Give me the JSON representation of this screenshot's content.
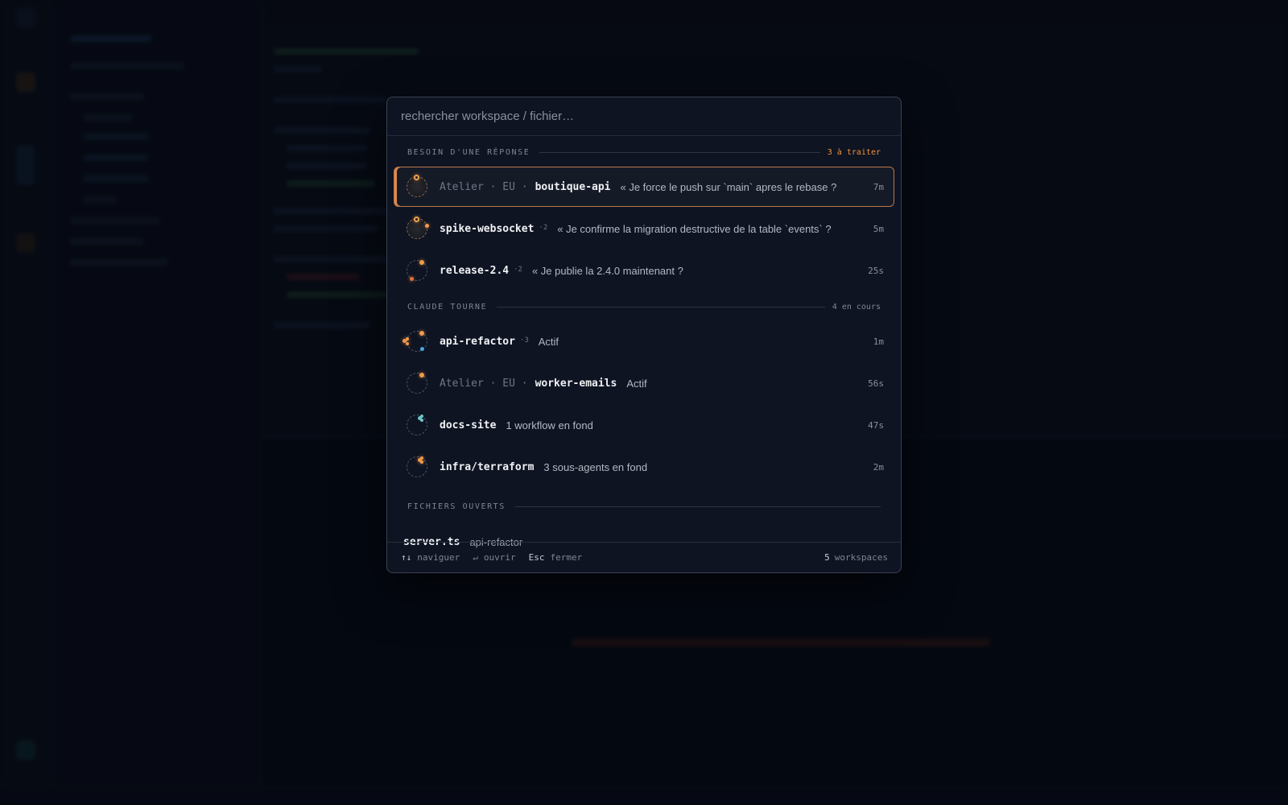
{
  "search": {
    "placeholder": "rechercher workspace / fichier…"
  },
  "sections": {
    "needs_reply": {
      "title": "BESOIN D'UNE RÉPONSE",
      "count": "3 à traiter"
    },
    "running": {
      "title": "CLAUDE TOURNE",
      "count": "4 en cours"
    },
    "open_files": {
      "title": "FICHIERS OUVERTS"
    }
  },
  "needs_reply_rows": [
    {
      "prefix": "Atelier · EU ·",
      "name": "boutique-api",
      "badge": "",
      "message": "« Je force le push sur `main` apres le rebase ?",
      "time": "7m"
    },
    {
      "prefix": "",
      "name": "spike-websocket",
      "badge": "·2",
      "message": "« Je confirme la migration destructive de la table `events` ?",
      "time": "5m"
    },
    {
      "prefix": "",
      "name": "release-2.4",
      "badge": "·2",
      "message": "« Je publie la 2.4.0 maintenant ?",
      "time": "25s"
    }
  ],
  "running_rows": [
    {
      "prefix": "",
      "name": "api-refactor",
      "badge": "·3",
      "message": "Actif",
      "time": "1m"
    },
    {
      "prefix": "Atelier · EU ·",
      "name": "worker-emails",
      "badge": "",
      "message": "Actif",
      "time": "56s"
    },
    {
      "prefix": "",
      "name": "docs-site",
      "badge": "",
      "message": "1 workflow en fond",
      "time": "47s"
    },
    {
      "prefix": "",
      "name": "infra/terraform",
      "badge": "",
      "message": "3 sous-agents en fond",
      "time": "2m"
    }
  ],
  "open_files": [
    {
      "name": "server.ts",
      "workspace": "api-refactor"
    }
  ],
  "footer": {
    "navigate_key": "↑↓",
    "navigate_label": "naviguer",
    "open_key": "↵",
    "open_label": "ouvrir",
    "close_key": "Esc",
    "close_label": "fermer",
    "workspace_count": "5",
    "workspace_label": "workspaces"
  },
  "colors": {
    "accent": "#f0913c",
    "active_border": "#b9784a",
    "status_blue": "#4aa8e0",
    "status_teal": "#6fc6c8"
  },
  "icons": {
    "workspace": "workspace-status-ring-icon",
    "attention": "attention-ring-icon"
  }
}
